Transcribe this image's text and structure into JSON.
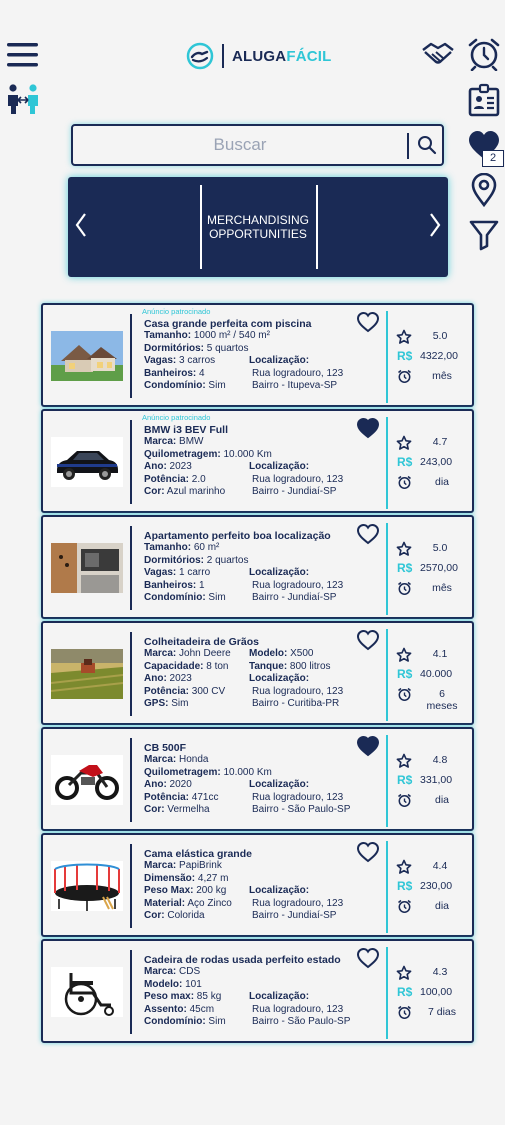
{
  "header": {
    "brand_part1": "ALUGA",
    "brand_part2": "FÁCIL",
    "favorites_count": "2"
  },
  "search": {
    "placeholder": "Buscar"
  },
  "banner": {
    "text": "MERCHANDISING OPPORTUNITIES"
  },
  "colors": {
    "navy": "#1a2a55",
    "accent": "#2fc6d6",
    "background": "#f4f4f4"
  },
  "listings": [
    {
      "sponsor": "Anúncio patrocinado",
      "title": "Casa grande perfeita com piscina",
      "image": "house",
      "favorited": false,
      "left": [
        {
          "k": "Tamanho:",
          "v": " 1000 m² / 540 m²"
        },
        {
          "k": "Dormitórios:",
          "v": " 5 quartos"
        },
        {
          "k": "Vagas:",
          "v": " 3 carros"
        },
        {
          "k": "Banheiros:",
          "v": " 4"
        },
        {
          "k": "Condomínio:",
          "v": " Sim"
        }
      ],
      "right": [
        {
          "k": "Localização:",
          "v": ""
        },
        {
          "k": "",
          "v": "Rua logradouro, 123"
        },
        {
          "k": "",
          "v": "Bairro - Itupeva-SP"
        }
      ],
      "rating": "5.0",
      "currency": "R$",
      "price": "4322,00",
      "period": "mês"
    },
    {
      "sponsor": "Anúncio patrocinado",
      "title": "BMW i3 BEV Full",
      "image": "car",
      "favorited": true,
      "left": [
        {
          "k": "Marca:",
          "v": " BMW"
        },
        {
          "k": "Quilometragem:",
          "v": " 10.000 Km"
        },
        {
          "k": "Ano:",
          "v": " 2023"
        },
        {
          "k": "Potência:",
          "v": " 2.0"
        },
        {
          "k": "Cor:",
          "v": " Azul marinho"
        }
      ],
      "right": [
        {
          "k": "Localização:",
          "v": ""
        },
        {
          "k": "",
          "v": "Rua logradouro, 123"
        },
        {
          "k": "",
          "v": "Bairro - Jundiaí-SP"
        }
      ],
      "rating": "4.7",
      "currency": "R$",
      "price": "243,00",
      "period": "dia"
    },
    {
      "sponsor": "",
      "title": "Apartamento perfeito boa localização",
      "image": "apartment",
      "favorited": false,
      "left": [
        {
          "k": "Tamanho:",
          "v": " 60 m²"
        },
        {
          "k": "Dormitórios:",
          "v": " 2 quartos"
        },
        {
          "k": "Vagas:",
          "v": " 1 carro"
        },
        {
          "k": "Banheiros:",
          "v": " 1"
        },
        {
          "k": "Condomínio:",
          "v": " Sim"
        }
      ],
      "right": [
        {
          "k": "Localização:",
          "v": ""
        },
        {
          "k": "",
          "v": "Rua logradouro, 123"
        },
        {
          "k": "",
          "v": "Bairro - Jundiaí-SP"
        }
      ],
      "rating": "5.0",
      "currency": "R$",
      "price": "2570,00",
      "period": "mês"
    },
    {
      "sponsor": "",
      "title": "Colheitadeira de Grãos",
      "image": "harvester",
      "favorited": false,
      "left": [
        {
          "k": "Marca:",
          "v": " John Deere"
        },
        {
          "k": "Capacidade:",
          "v": " 8 ton"
        },
        {
          "k": "Ano:",
          "v": " 2023"
        },
        {
          "k": "Potência:",
          "v": " 300 CV"
        },
        {
          "k": "GPS:",
          "v": " Sim"
        }
      ],
      "right": [
        {
          "k": "Modelo:",
          "v": " X500"
        },
        {
          "k": "Tanque:",
          "v": " 800 litros"
        },
        {
          "k": "Localização:",
          "v": ""
        },
        {
          "k": "",
          "v": "Rua logradouro, 123"
        },
        {
          "k": "",
          "v": "Bairro - Curitiba-PR"
        }
      ],
      "rating": "4.1",
      "currency": "R$",
      "price": "40.000",
      "period": "6 meses"
    },
    {
      "sponsor": "",
      "title": "CB 500F",
      "image": "motorcycle",
      "favorited": true,
      "left": [
        {
          "k": "Marca:",
          "v": " Honda"
        },
        {
          "k": "Quilometragem:",
          "v": " 10.000 Km"
        },
        {
          "k": "Ano:",
          "v": " 2020"
        },
        {
          "k": "Potência:",
          "v": " 471cc"
        },
        {
          "k": "Cor:",
          "v": " Vermelha"
        }
      ],
      "right": [
        {
          "k": "Localização:",
          "v": ""
        },
        {
          "k": "",
          "v": "Rua logradouro, 123"
        },
        {
          "k": "",
          "v": "Bairro - São Paulo-SP"
        }
      ],
      "rating": "4.8",
      "currency": "R$",
      "price": "331,00",
      "period": "dia"
    },
    {
      "sponsor": "",
      "title": "Cama elástica grande",
      "image": "trampoline",
      "favorited": false,
      "left": [
        {
          "k": "Marca:",
          "v": " PapiBrink"
        },
        {
          "k": "Dimensão:",
          "v": " 4,27 m"
        },
        {
          "k": "Peso Max:",
          "v": " 200 kg"
        },
        {
          "k": "Material:",
          "v": " Aço Zinco"
        },
        {
          "k": "Cor:",
          "v": " Colorida"
        }
      ],
      "right": [
        {
          "k": "Localização:",
          "v": ""
        },
        {
          "k": "",
          "v": "Rua logradouro, 123"
        },
        {
          "k": "",
          "v": "Bairro - Jundiaí-SP"
        }
      ],
      "rating": "4.4",
      "currency": "R$",
      "price": "230,00",
      "period": "dia"
    },
    {
      "sponsor": "",
      "title": "Cadeira de rodas usada perfeito estado",
      "image": "wheelchair",
      "favorited": false,
      "left": [
        {
          "k": "Marca:",
          "v": " CDS"
        },
        {
          "k": "Modelo:",
          "v": " 101"
        },
        {
          "k": "Peso max:",
          "v": " 85 kg"
        },
        {
          "k": "Assento:",
          "v": " 45cm"
        },
        {
          "k": "Condomínio:",
          "v": " Sim"
        }
      ],
      "right": [
        {
          "k": "Localização:",
          "v": ""
        },
        {
          "k": "",
          "v": "Rua logradouro, 123"
        },
        {
          "k": "",
          "v": "Bairro - São Paulo-SP"
        }
      ],
      "rating": "4.3",
      "currency": "R$",
      "price": "100,00",
      "period": "7 dias"
    }
  ]
}
